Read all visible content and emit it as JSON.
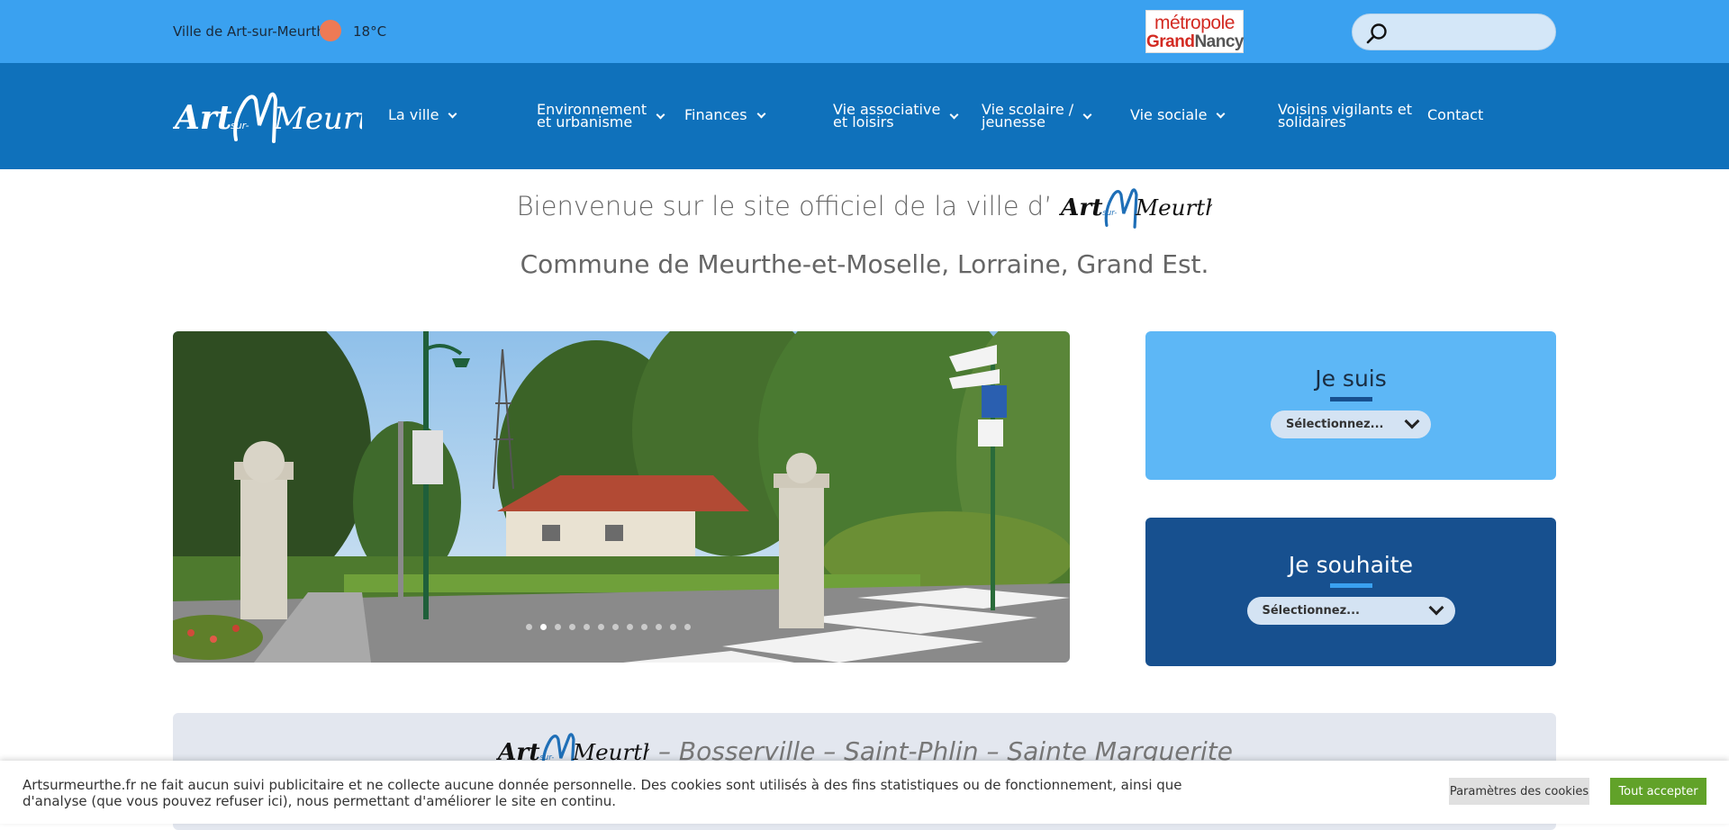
{
  "topbar": {
    "city": "Ville de Art-sur-Meurthe",
    "weather_icon": "sun-icon",
    "temperature": "18°C",
    "partner_logo_line1": "métropole",
    "partner_logo_line2a": "Grand",
    "partner_logo_line2b": "Nancy",
    "search_placeholder": ""
  },
  "logo": {
    "part1": "Art",
    "part2": "-sur-",
    "part3": "Meurthe"
  },
  "nav": {
    "items": [
      {
        "label_l1": "La ville",
        "label_l2": ""
      },
      {
        "label_l1": "Environnement",
        "label_l2": "et urbanisme"
      },
      {
        "label_l1": "Finances",
        "label_l2": ""
      },
      {
        "label_l1": "Vie associative",
        "label_l2": "et loisirs"
      },
      {
        "label_l1": "Vie scolaire /",
        "label_l2": "jeunesse"
      },
      {
        "label_l1": "Vie sociale",
        "label_l2": ""
      },
      {
        "label_l1": "Voisins vigilants et",
        "label_l2": "solidaires"
      },
      {
        "label_l1": "Contact",
        "label_l2": ""
      }
    ]
  },
  "main": {
    "welcome": "Bienvenue sur le site officiel de la ville d’",
    "subtitle": "Commune de Meurthe-et-Moselle, Lorraine, Grand Est.",
    "slider_dots": 12,
    "slider_active_dot": 1
  },
  "cards": {
    "je_suis": {
      "title": "Je suis",
      "select_value": "Sélectionnez..."
    },
    "je_souhaite": {
      "title": "Je souhaite",
      "select_value": "Sélectionnez..."
    }
  },
  "banner": {
    "text": "– Bosserville – Saint-Phlin – Sainte Marguerite"
  },
  "cookie": {
    "message": "Artsurmeurthe.fr ne fait aucun suivi publicitaire et ne collecte aucune donnée personnelle. Des cookies sont utilisés à des fins statistiques ou de fonctionnement, ainsi que d'analyse (que vous pouvez refuser ici), nous permettant d'améliorer le site en continu.",
    "settings_label": "Paramètres des cookies",
    "accept_label": "Tout accepter"
  },
  "colors": {
    "topbar": "#3aa1f0",
    "navbar": "#0f71bb",
    "card_light": "#5db7f6",
    "card_dark": "#17508f",
    "accept_green": "#61a229"
  }
}
